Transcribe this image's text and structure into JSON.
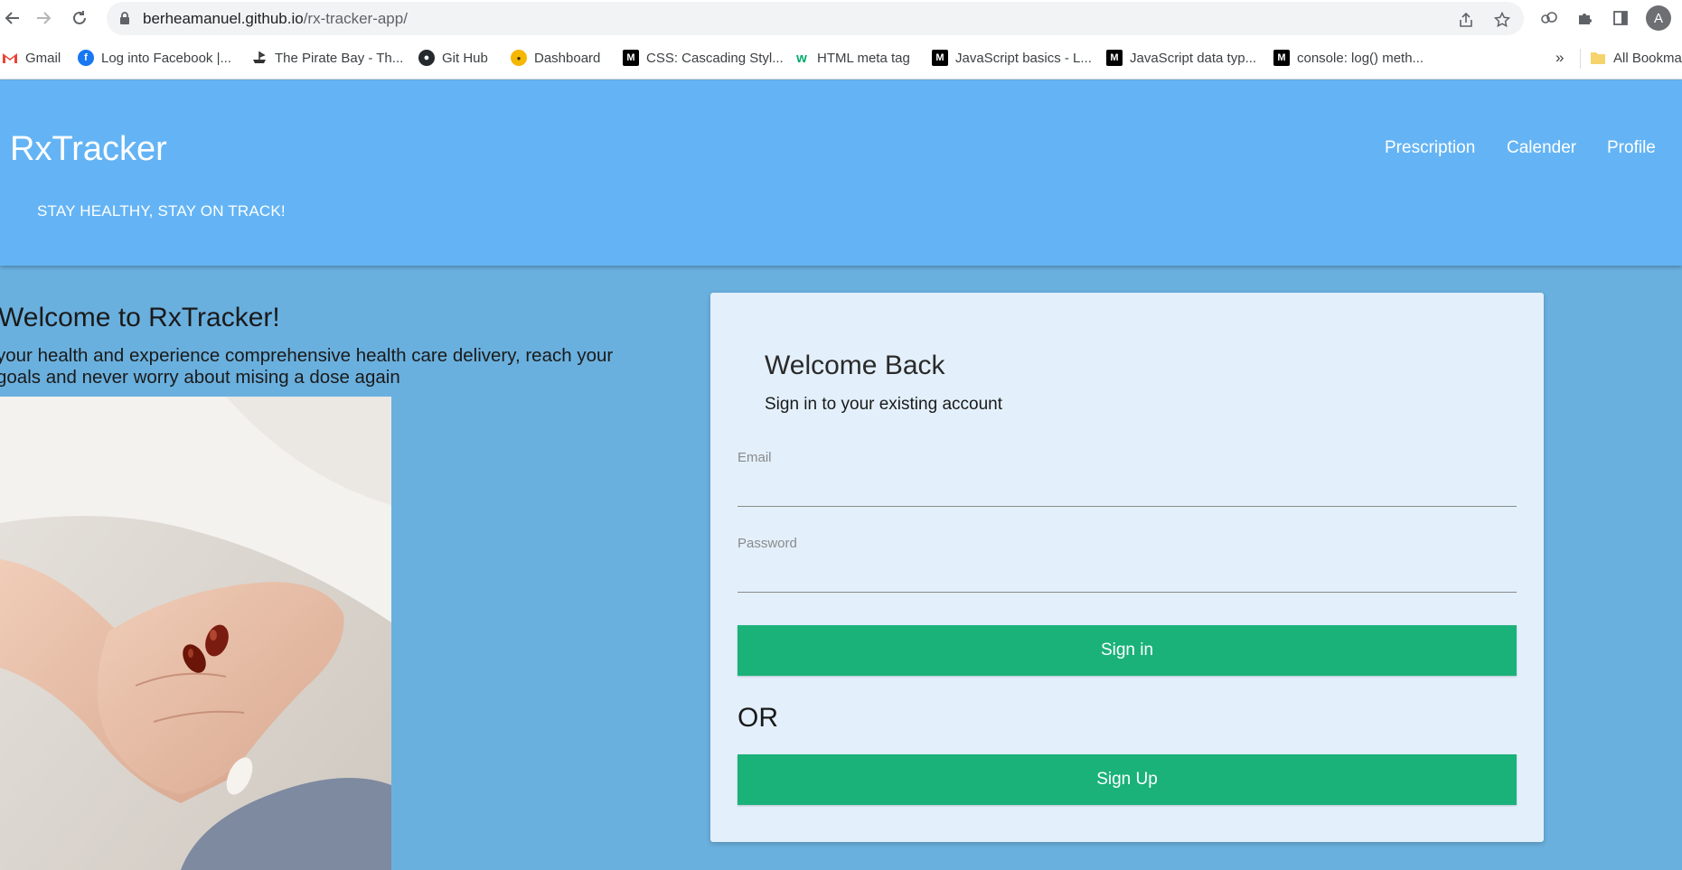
{
  "browser": {
    "url_host": "berheamanuel.github.io",
    "url_path": "/rx-tracker-app/",
    "profile_initial": "A",
    "bookmarks_overflow": "»",
    "bookmarks": [
      {
        "label": "Gmail",
        "icon": "gmail-icon"
      },
      {
        "label": "Log into Facebook |...",
        "icon": "facebook-icon"
      },
      {
        "label": "The Pirate Bay - Th...",
        "icon": "pirate-ship-icon"
      },
      {
        "label": "Git Hub",
        "icon": "github-icon"
      },
      {
        "label": "Dashboard",
        "icon": "dashboard-icon"
      },
      {
        "label": "CSS: Cascading Styl...",
        "icon": "mdn-icon"
      },
      {
        "label": "HTML meta tag",
        "icon": "w3schools-icon"
      },
      {
        "label": "JavaScript basics - L...",
        "icon": "mdn-icon"
      },
      {
        "label": "JavaScript data typ...",
        "icon": "mdn-icon"
      },
      {
        "label": "console: log() meth...",
        "icon": "mdn-icon"
      }
    ],
    "all_bookmarks": "All Bookma"
  },
  "header": {
    "brand": "RxTracker",
    "tagline": "STAY HEALTHY, STAY ON TRACK!",
    "nav": [
      "Prescription",
      "Calender",
      "Profile"
    ]
  },
  "hero": {
    "title": "Welcome to RxTracker!",
    "text": "your health and experience comprehensive health care delivery, reach your goals and never worry about mising a dose again",
    "image": "hands-holding-capsules-photo"
  },
  "login": {
    "title": "Welcome Back",
    "subtitle": "Sign in to your existing account",
    "email_label": "Email",
    "password_label": "Password",
    "signin_label": "Sign in",
    "or_label": "OR",
    "signup_label": "Sign Up"
  },
  "colors": {
    "header_bg": "#64b4f5",
    "page_bg": "#6ab0de",
    "card_bg": "#e3f0fb",
    "button_green": "#1bb27a"
  }
}
